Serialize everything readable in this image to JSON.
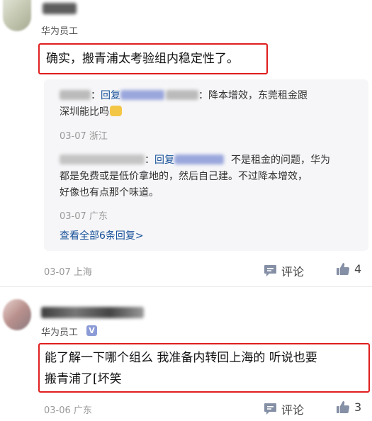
{
  "comment1": {
    "role": "华为员工",
    "text": "确实，搬青浦太考验组内稳定性了。",
    "date": "03-07 上海",
    "comment_label": "评论",
    "likes": "4"
  },
  "replies": [
    {
      "reply_word": "回复",
      "text_line1": "：降本增效，东莞租金跟",
      "text_line2": "深圳能比吗",
      "meta": "03-07 浙江"
    },
    {
      "reply_word": "回复",
      "text_line1": "不是租金的问题，华为",
      "text_line2": "都是免费或是低价拿地的，然后自己建。不过降本增效，",
      "text_line3": "好像也有点那个味道。",
      "meta": "03-07 广东"
    }
  ],
  "view_all": "查看全部6条回复>",
  "comment2": {
    "role": "华为员工",
    "verified_mark": "V",
    "text_line1": "能了解一下哪个组么 我准备内转回上海的 听说也要",
    "text_line2": "搬青浦了[坏笑",
    "date": "03-06 广东",
    "comment_label": "评论",
    "likes": "3"
  },
  "colors": {
    "highlight_border": "#e01e1e",
    "link": "#175199",
    "meta": "#999999"
  }
}
